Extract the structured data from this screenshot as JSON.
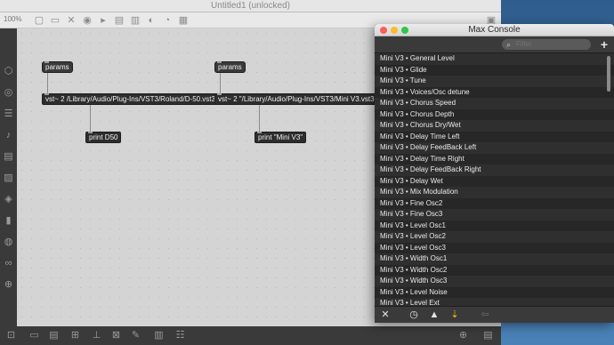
{
  "patcher": {
    "title": "Untitled1 (unlocked)",
    "zoom": "100%",
    "objects": {
      "params_left": "params",
      "vst_left": "vst~ 2 /Library/Audio/Plug-Ins/VST3/Roland/D-50.vst3",
      "print_left": "print D50",
      "params_right": "params",
      "vst_right": "vst~ 2 \"/Library/Audio/Plug-Ins/VST3/Mini V3.vst3\"",
      "print_right": "print \"Mini V3\""
    }
  },
  "console": {
    "title": "Max Console",
    "search_placeholder": "Filter",
    "add_label": "+",
    "rows": [
      "Mini V3 • General Level",
      "Mini V3 • Glide",
      "Mini V3 • Tune",
      "Mini V3 • Voices/Osc detune",
      "Mini V3 • Chorus Speed",
      "Mini V3 • Chorus Depth",
      "Mini V3 • Chorus Dry/Wet",
      "Mini V3 • Delay Time Left",
      "Mini V3 • Delay FeedBack Left",
      "Mini V3 • Delay Time Right",
      "Mini V3 • Delay FeedBack Right",
      "Mini V3 • Delay Wet",
      "Mini V3 • Mix Modulation",
      "Mini V3 • Fine Osc2",
      "Mini V3 • Fine Osc3",
      "Mini V3 • Level Osc1",
      "Mini V3 • Level Osc2",
      "Mini V3 • Level Osc3",
      "Mini V3 • Width Osc1",
      "Mini V3 • Width Osc2",
      "Mini V3 • Width Osc3",
      "Mini V3 • Level Noise",
      "Mini V3 • Level Ext"
    ],
    "colors": {
      "close": "#fc5f57",
      "minimize": "#fdbc2e",
      "zoom": "#33c748",
      "active_tool": "#f5c400"
    }
  }
}
